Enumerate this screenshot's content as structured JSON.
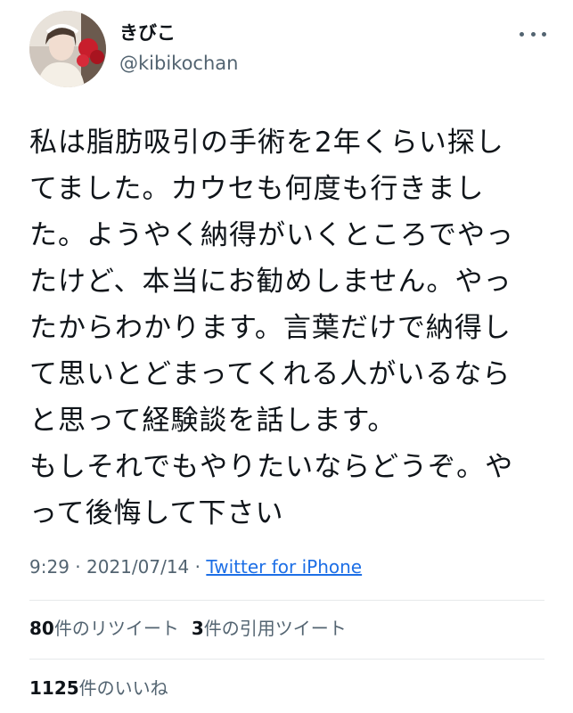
{
  "user": {
    "display_name": "きびこ",
    "handle": "@kibikochan"
  },
  "tweet": {
    "lines": [
      "私は脂肪吸引の手術を2年くらい探し",
      "てました。カウセも何度も行きまし",
      "た。ようやく納得がいくところでやっ",
      "たけど、本当にお勧めしません。やっ",
      "たからわかります。言葉だけで納得し",
      "て思いとどまってくれる人がいるなら",
      "と思って経験談を話します。",
      "もしそれでもやりたいならどうぞ。や",
      "って後悔して下さい"
    ]
  },
  "meta": {
    "time": "9:29",
    "separator": "·",
    "date": "2021/07/14",
    "source": "Twitter for iPhone"
  },
  "stats": {
    "retweets_count": "80",
    "retweets_label": "件のリツイート",
    "quotes_count": "3",
    "quotes_label": "件の引用ツイート",
    "likes_count": "1125",
    "likes_label": "件のいいね"
  },
  "icons": {
    "more": "more-horizontal-icon",
    "avatar": "profile-avatar"
  }
}
